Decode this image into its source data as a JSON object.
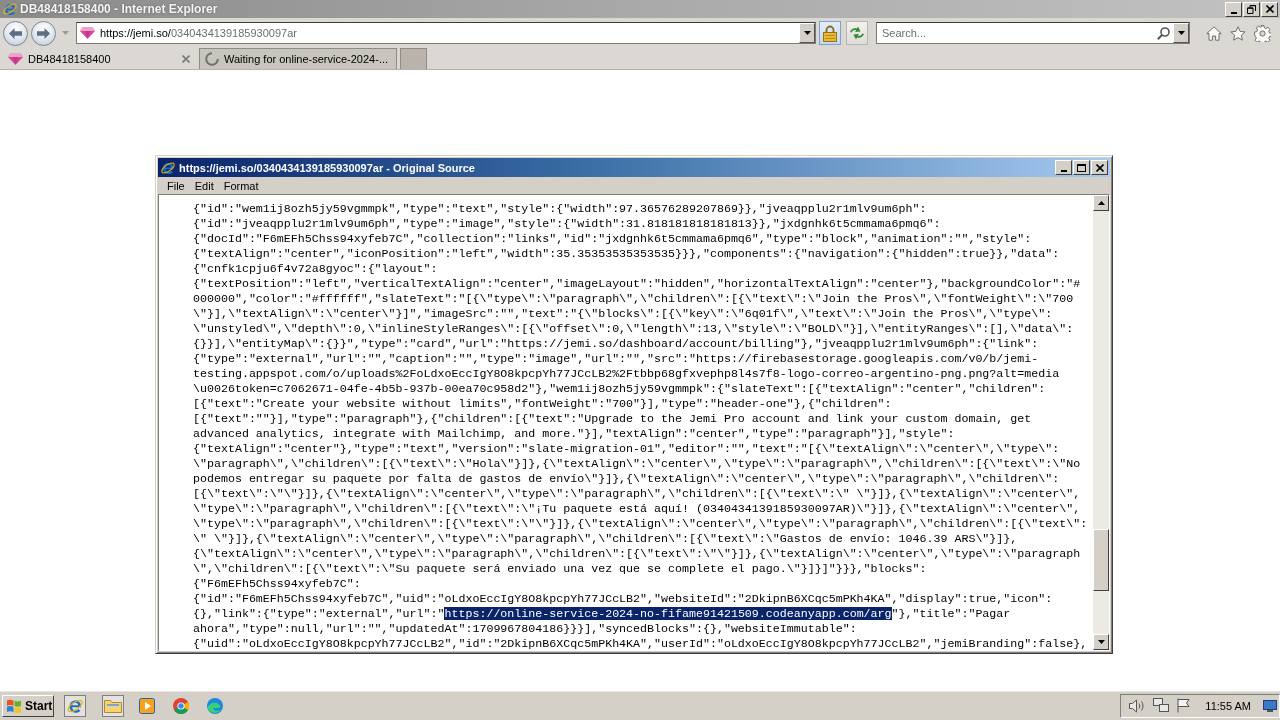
{
  "window": {
    "title": "DB48418158400 - Internet Explorer"
  },
  "address_bar": {
    "url_host": "https://jemi.so/",
    "url_path": "0340434139185930097ar"
  },
  "search": {
    "placeholder": "Search..."
  },
  "tabs": [
    {
      "label": "DB48418158400",
      "selected": true,
      "loading": false
    },
    {
      "label": "Waiting for online-service-2024-...",
      "selected": false,
      "loading": true
    }
  ],
  "source_window": {
    "title": "https://jemi.so/0340434139185930097ar - Original Source",
    "menu": [
      "File",
      "Edit",
      "Format"
    ],
    "lines": [
      {
        "text": "{\"id\":\"wem1ij8ozh5jy59vgmmpk\",\"type\":\"text\",\"style\":{\"width\":97.36576289207869}},\"jveaqpplu2r1mlv9um6ph\":"
      },
      {
        "text": "{\"id\":\"jveaqpplu2r1mlv9um6ph\",\"type\":\"image\",\"style\":{\"width\":31.818181818181813}},\"jxdgnhk6t5cmmama6pmq6\":"
      },
      {
        "text": "{\"docId\":\"F6mEFh5Chss94xyfeb7C\",\"collection\":\"links\",\"id\":\"jxdgnhk6t5cmmama6pmq6\",\"type\":\"block\",\"animation\":\"\",\"style\":"
      },
      {
        "text": "{\"textAlign\":\"center\",\"iconPosition\":\"left\",\"width\":35.35353535353535}}},\"components\":{\"navigation\":{\"hidden\":true}},\"data\":"
      },
      {
        "text": "{\"cnfk1cpju6f4v72a8gyoc\":{\"layout\":"
      },
      {
        "text": "{\"textPosition\":\"left\",\"verticalTextAlign\":\"center\",\"imageLayout\":\"hidden\",\"horizontalTextAlign\":\"center\"},\"backgroundColor\":\"#"
      },
      {
        "text": "000000\",\"color\":\"#ffffff\",\"slateText\":\"[{\\\"type\\\":\\\"paragraph\\\",\\\"children\\\":[{\\\"text\\\":\\\"Join the Pros\\\",\\\"fontWeight\\\":\\\"700"
      },
      {
        "text": "\\\"}],\\\"textAlign\\\":\\\"center\\\"}]\",\"imageSrc\":\"\",\"text\":\"{\\\"blocks\\\":[{\\\"key\\\":\\\"6q01f\\\",\\\"text\\\":\\\"Join the Pros\\\",\\\"type\\\":"
      },
      {
        "text": "\\\"unstyled\\\",\\\"depth\\\":0,\\\"inlineStyleRanges\\\":[{\\\"offset\\\":0,\\\"length\\\":13,\\\"style\\\":\\\"BOLD\\\"}],\\\"entityRanges\\\":[],\\\"data\\\":"
      },
      {
        "text": "{}}],\\\"entityMap\\\":{}}\",\"type\":\"card\",\"url\":\"https://jemi.so/dashboard/account/billing\"},\"jveaqpplu2r1mlv9um6ph\":{\"link\":"
      },
      {
        "text": "{\"type\":\"external\",\"url\":\"\",\"caption\":\"\",\"type\":\"image\",\"url\":\"\",\"src\":\"https://firebasestorage.googleapis.com/v0/b/jemi-"
      },
      {
        "text": "testing.appspot.com/o/uploads%2FoLdxoEccIgY8O8kpcpYh77JCcLB2%2Ftbbp68gfxvephp8l4s7f8-logo-correo-argentino-png.png?alt=media"
      },
      {
        "text": "\\u0026token=c7062671-04fe-4b5b-937b-00ea70c958d2\"},\"wem1ij8ozh5jy59vgmmpk\":{\"slateText\":[{\"textAlign\":\"center\",\"children\":"
      },
      {
        "text": "[{\"text\":\"Create your website without limits\",\"fontWeight\":\"700\"}],\"type\":\"header-one\"},{\"children\":"
      },
      {
        "text": "[{\"text\":\"\"}],\"type\":\"paragraph\"},{\"children\":[{\"text\":\"Upgrade to the Jemi Pro account and link your custom domain, get"
      },
      {
        "text": "advanced analytics, integrate with Mailchimp, and more.\"}],\"textAlign\":\"center\",\"type\":\"paragraph\"}],\"style\":"
      },
      {
        "text": "{\"textAlign\":\"center\"},\"type\":\"text\",\"version\":\"slate-migration-01\",\"editor\":\"\",\"text\":\"[{\\\"textAlign\\\":\\\"center\\\",\\\"type\\\":"
      },
      {
        "text": "\\\"paragraph\\\",\\\"children\\\":[{\\\"text\\\":\\\"Hola\\\"}]},{\\\"textAlign\\\":\\\"center\\\",\\\"type\\\":\\\"paragraph\\\",\\\"children\\\":[{\\\"text\\\":\\\"No"
      },
      {
        "text": "podemos entregar su paquete por falta de gastos de envío\\\"}]},{\\\"textAlign\\\":\\\"center\\\",\\\"type\\\":\\\"paragraph\\\",\\\"children\\\":"
      },
      {
        "text": "[{\\\"text\\\":\\\"\\\"}]},{\\\"textAlign\\\":\\\"center\\\",\\\"type\\\":\\\"paragraph\\\",\\\"children\\\":[{\\\"text\\\":\\\" \\\"}]},{\\\"textAlign\\\":\\\"center\\\","
      },
      {
        "text": "\\\"type\\\":\\\"paragraph\\\",\\\"children\\\":[{\\\"text\\\":\\\"¡Tu paquete está aquí! (0340434139185930097AR)\\\"}]},{\\\"textAlign\\\":\\\"center\\\","
      },
      {
        "text": "\\\"type\\\":\\\"paragraph\\\",\\\"children\\\":[{\\\"text\\\":\\\"\\\"}]},{\\\"textAlign\\\":\\\"center\\\",\\\"type\\\":\\\"paragraph\\\",\\\"children\\\":[{\\\"text\\\":"
      },
      {
        "text": "\\\" \\\"}]},{\\\"textAlign\\\":\\\"center\\\",\\\"type\\\":\\\"paragraph\\\",\\\"children\\\":[{\\\"text\\\":\\\"Gastos de envío: 1046.39 ARS\\\"}]},"
      },
      {
        "text": "{\\\"textAlign\\\":\\\"center\\\",\\\"type\\\":\\\"paragraph\\\",\\\"children\\\":[{\\\"text\\\":\\\"\\\"}]},{\\\"textAlign\\\":\\\"center\\\",\\\"type\\\":\\\"paragraph"
      },
      {
        "text": "\\\",\\\"children\\\":[{\\\"text\\\":\\\"Su paquete será enviado una vez que se complete el pago.\\\"}]}]\"}}},\"blocks\":"
      },
      {
        "text": "{\"F6mEFh5Chss94xyfeb7C\":"
      },
      {
        "text": "{\"id\":\"F6mEFh5Chss94xyfeb7C\",\"uid\":\"oLdxoEccIgY8O8kpcpYh77JCcLB2\",\"websiteId\":\"2DkipnB6XCqc5mPKh4KA\",\"display\":true,\"icon\":"
      },
      {
        "parts": [
          {
            "text": "{},\"link\":{\"type\":\"external\",\"url\":\"",
            "selected": false
          },
          {
            "text": "https://online-service-2024-no-fifame91421509.codeanyapp.com/arg",
            "selected": true
          },
          {
            "text": "\"},\"title\":\"Pagar",
            "selected": false
          }
        ]
      },
      {
        "text": "ahora\",\"type\":null,\"url\":\"\",\"updatedAt\":1709967804186}}}],\"syncedBlocks\":{},\"websiteImmutable\":"
      },
      {
        "text": "{\"uid\":\"oLdxoEccIgY8O8kpcpYh77JCcLB2\",\"id\":\"2DkipnB6XCqc5mPKh4KA\",\"userId\":\"oLdxoEccIgY8O8kpcpYh77JCcLB2\",\"jemiBranding\":false},"
      }
    ]
  },
  "taskbar": {
    "start": "Start",
    "clock": "11:55 AM"
  }
}
